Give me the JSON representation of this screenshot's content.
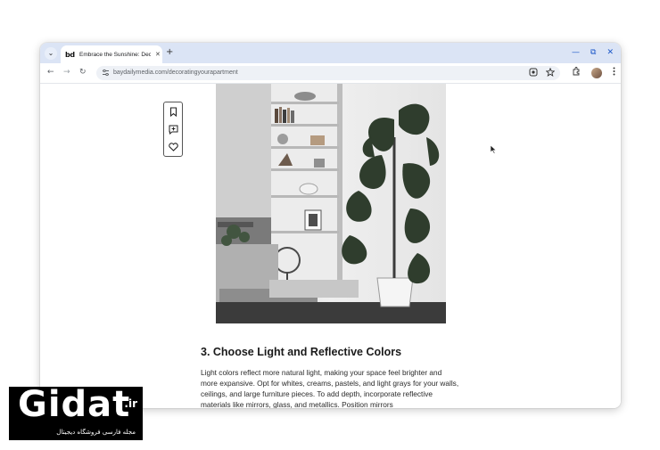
{
  "browser": {
    "tab": {
      "favicon_text": "bd",
      "title": "Embrace the Sunshine: Deco",
      "close_glyph": "✕"
    },
    "tab_search_glyph": "⌄",
    "new_tab_glyph": "+",
    "window_buttons": {
      "minimize": "—",
      "restore": "⧉",
      "close": "✕"
    },
    "nav": {
      "back": "←",
      "forward": "→",
      "reload": "↻"
    },
    "url": "baydailymedia.com/decoratingyourapartment",
    "icons": [
      "site-info-icon",
      "lens-icon",
      "bookmark-star-icon",
      "extensions-icon",
      "avatar",
      "kebab-menu-icon"
    ]
  },
  "article": {
    "side_actions": [
      "bookmark-icon",
      "comment-add-icon",
      "heart-icon"
    ],
    "heading": "3. Choose Light and Reflective Colors",
    "body": "Light colors reflect more natural light, making your space feel brighter and more expansive. Opt for whites, creams, pastels, and light grays for your walls, ceilings, and large furniture pieces. To add depth, incorporate reflective materials like mirrors, glass, and metallics. Position mirrors"
  },
  "watermark": {
    "logo": "Gidat",
    "tld": ".ir",
    "tagline": "مجله فارسی فروشگاه دیجیتال"
  },
  "colors": {
    "tabstrip": "#dbe4f5",
    "accent_blue": "#1a56c8",
    "omnibox": "#eef1f6"
  }
}
